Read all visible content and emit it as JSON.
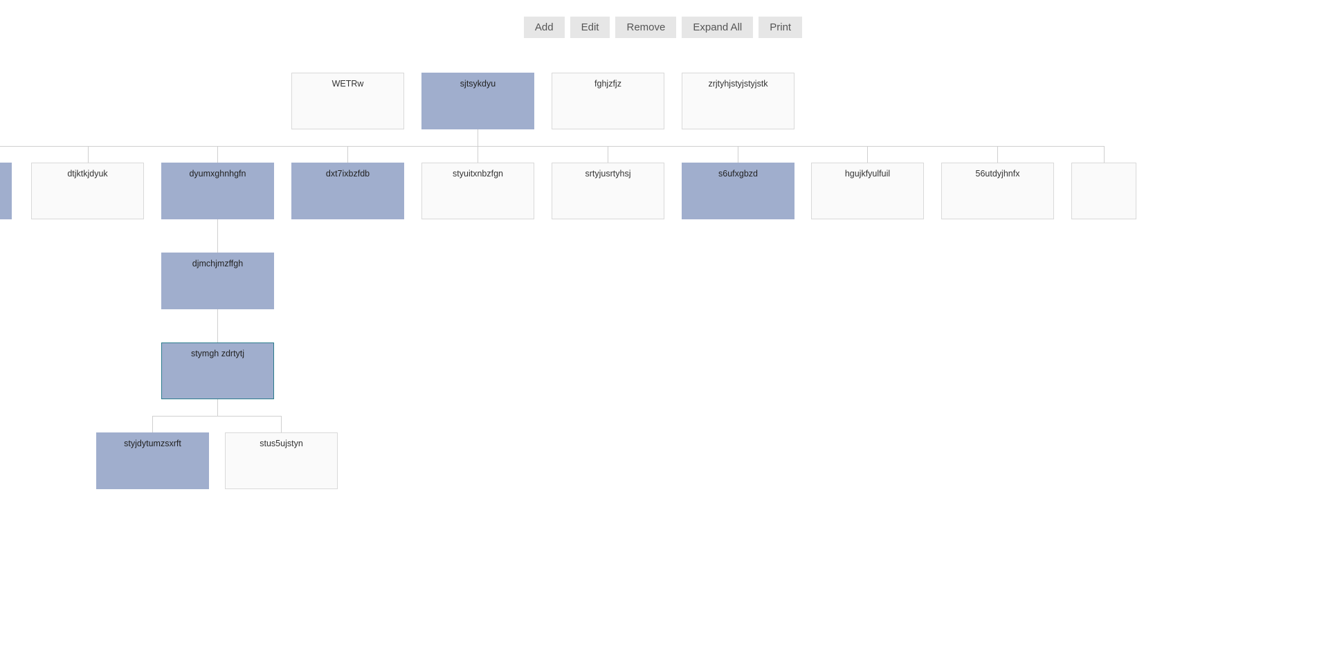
{
  "toolbar": {
    "add": "Add",
    "edit": "Edit",
    "remove": "Remove",
    "expand_all": "Expand All",
    "print": "Print"
  },
  "nodes": {
    "row1": [
      {
        "label": "WETRw",
        "highlight": false
      },
      {
        "label": "sjtsykdyu",
        "highlight": true
      },
      {
        "label": "fghjzfjz",
        "highlight": false
      },
      {
        "label": "zrjtyhjstyjstyjstk",
        "highlight": false
      }
    ],
    "row2": [
      {
        "label": "",
        "highlight": true,
        "partial_left": true
      },
      {
        "label": "dtjktkjdyuk",
        "highlight": false
      },
      {
        "label": "dyumxghnhgfn",
        "highlight": true
      },
      {
        "label": "dxt7ixbzfdb",
        "highlight": true
      },
      {
        "label": "styuitxnbzfgn",
        "highlight": false
      },
      {
        "label": "srtyjusrtyhsj",
        "highlight": false
      },
      {
        "label": "s6ufxgbzd",
        "highlight": true
      },
      {
        "label": "hgujkfyulfuil",
        "highlight": false
      },
      {
        "label": "56utdyjhnfx",
        "highlight": false
      },
      {
        "label": "",
        "highlight": false,
        "partial_right": true
      }
    ],
    "row3": {
      "label": "djmchjmzffgh",
      "highlight": true
    },
    "row4": {
      "label": "stymgh zdrtytj",
      "highlight": true,
      "selected": true
    },
    "row5": [
      {
        "label": "styjdytumzsxrft",
        "highlight": true
      },
      {
        "label": "stus5ujstyn",
        "highlight": false
      }
    ]
  }
}
